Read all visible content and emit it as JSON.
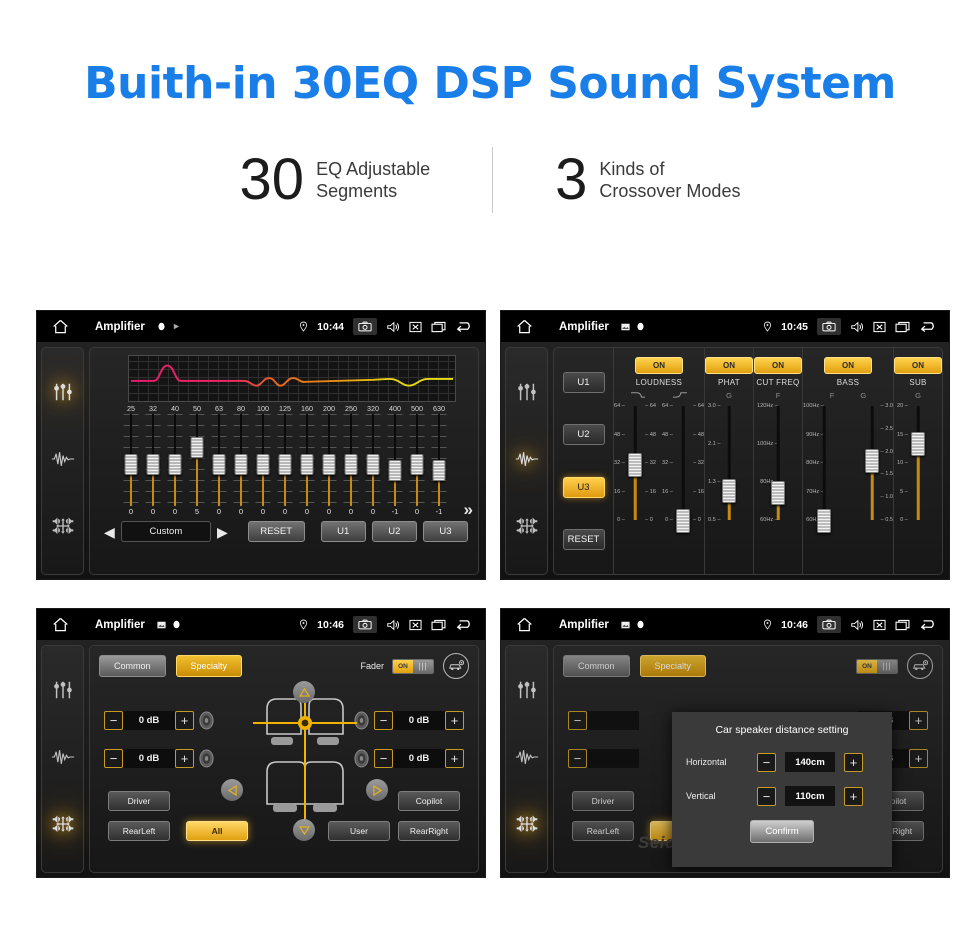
{
  "header": {
    "title": "Buith-in 30EQ DSP Sound System",
    "stats": [
      {
        "number": "30",
        "line1": "EQ Adjustable",
        "line2": "Segments"
      },
      {
        "number": "3",
        "line1": "Kinds of",
        "line2": "Crossover Modes"
      }
    ]
  },
  "statusbar": {
    "app_title": "Amplifier",
    "time_p1": "10:44",
    "time_p2": "10:45",
    "time_p3": "10:46",
    "time_p4": "10:46",
    "icons": [
      "home-icon",
      "location-pin-icon",
      "camera-icon",
      "volume-icon",
      "close-box-icon",
      "recents-icon",
      "back-icon"
    ]
  },
  "sidebar": {
    "items": [
      {
        "name": "equalizer-icon",
        "label": "Equalizer"
      },
      {
        "name": "waveform-icon",
        "label": "Crossover"
      },
      {
        "name": "balance-icon",
        "label": "Fader"
      }
    ]
  },
  "eq_panel": {
    "frequencies": [
      "25",
      "32",
      "40",
      "50",
      "63",
      "80",
      "100",
      "125",
      "160",
      "200",
      "250",
      "320",
      "400",
      "500",
      "630"
    ],
    "values": [
      "0",
      "0",
      "0",
      "5",
      "0",
      "0",
      "0",
      "0",
      "0",
      "0",
      "0",
      "0",
      "-1",
      "0",
      "-1"
    ],
    "knob_pct": [
      44,
      44,
      44,
      25,
      44,
      44,
      44,
      44,
      44,
      44,
      44,
      44,
      50,
      44,
      50
    ],
    "preset_label": "Custom",
    "prev_arrow": "◀",
    "next_arrow": "▶",
    "reset_label": "RESET",
    "user_presets": [
      "U1",
      "U2",
      "U3"
    ],
    "more_chevron": "»"
  },
  "crossover_panel": {
    "presets": [
      "U1",
      "U2",
      "U3"
    ],
    "selected_preset": "U3",
    "reset_label": "RESET",
    "columns": [
      {
        "name": "LOUDNESS",
        "state": "ON",
        "subs": [
          "curve-down-icon",
          "curve-up-icon"
        ],
        "sliders": [
          {
            "scale_left": [
              "64",
              "48",
              "32",
              "16",
              "0"
            ],
            "scale_right": [
              "64",
              "48",
              "32",
              "16",
              "0"
            ],
            "knob_pct": 42
          },
          {
            "scale_left": [
              "64",
              "48",
              "32",
              "16",
              "0"
            ],
            "scale_right": [
              "64",
              "48",
              "32",
              "16",
              "0"
            ],
            "knob_pct": 88
          }
        ]
      },
      {
        "name": "PHAT",
        "state": "ON",
        "subs": [
          "G"
        ],
        "sliders": [
          {
            "scale_left": [
              "3.0",
              "2.1",
              "1.3",
              "0.5"
            ],
            "scale_right": [],
            "knob_pct": 63
          }
        ]
      },
      {
        "name": "CUT FREQ",
        "state": "ON",
        "subs": [
          "F"
        ],
        "sliders": [
          {
            "scale_left": [
              "120Hz",
              "100Hz",
              "80Hz",
              "60Hz"
            ],
            "scale_right": [],
            "knob_pct": 65
          }
        ]
      },
      {
        "name": "BASS",
        "state": "ON",
        "subs": [
          "F",
          "G"
        ],
        "sliders": [
          {
            "scale_left": [
              "100Hz",
              "90Hz",
              "80Hz",
              "70Hz",
              "60Hz"
            ],
            "scale_right": [],
            "knob_pct": 88
          },
          {
            "scale_left": [],
            "scale_right": [
              "3.0",
              "2.5",
              "2.0",
              "1.5",
              "1.0",
              "0.5"
            ],
            "knob_pct": 38
          }
        ]
      },
      {
        "name": "SUB",
        "state": "ON",
        "subs": [
          "G"
        ],
        "sliders": [
          {
            "scale_left": [
              "20",
              "15",
              "10",
              "5",
              "0"
            ],
            "scale_right": [],
            "knob_pct": 24
          }
        ]
      }
    ]
  },
  "fader_panel": {
    "tabs": [
      {
        "label": "Common",
        "selected": false
      },
      {
        "label": "Specialty",
        "selected": true
      }
    ],
    "fader_label": "Fader",
    "fader_state": "ON",
    "car_icon": "car-settings-icon",
    "db_controls": [
      {
        "pos": "front-left",
        "minus": "−",
        "value": "0 dB",
        "plus": "+"
      },
      {
        "pos": "rear-left",
        "minus": "−",
        "value": "0 dB",
        "plus": "+"
      },
      {
        "pos": "front-right",
        "minus": "−",
        "value": "0 dB",
        "plus": "+"
      },
      {
        "pos": "rear-right",
        "minus": "−",
        "value": "0 dB",
        "plus": "+"
      }
    ],
    "seat_buttons": [
      {
        "label": "Driver",
        "selected": false
      },
      {
        "label": "Copilot",
        "selected": false
      },
      {
        "label": "RearLeft",
        "selected": false
      },
      {
        "label": "All",
        "selected": true
      },
      {
        "label": "User",
        "selected": false
      },
      {
        "label": "RearRight",
        "selected": false
      }
    ],
    "nav_arrows": [
      "up-arrow-icon",
      "down-arrow-icon",
      "left-arrow-icon",
      "right-arrow-icon"
    ],
    "watermark": "Seicane"
  },
  "modal": {
    "title": "Car speaker distance setting",
    "rows": [
      {
        "label": "Horizontal",
        "minus": "−",
        "value": "140cm",
        "plus": "+"
      },
      {
        "label": "Vertical",
        "minus": "−",
        "value": "110cm",
        "plus": "+"
      }
    ],
    "confirm_label": "Confirm"
  },
  "colors": {
    "brand_blue": "#1a7ee8",
    "amber": "#e0a010",
    "amber_light": "#ffd24d",
    "panel_bg": "#1b1b1b"
  }
}
